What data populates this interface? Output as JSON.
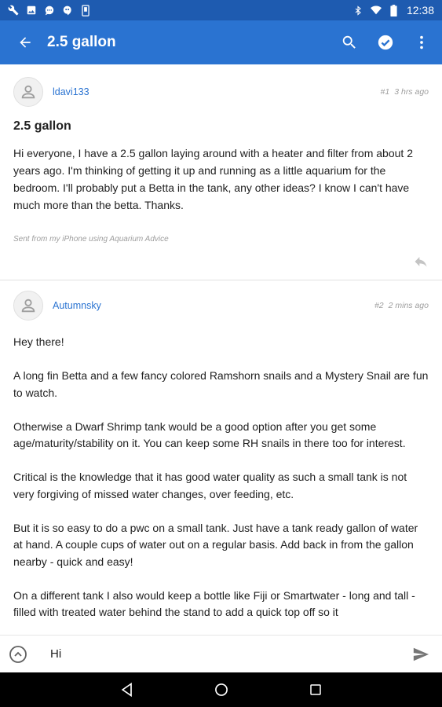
{
  "app": {
    "title": "2.5 gallon",
    "accent": "#2a73d1",
    "status_bar_color": "#1e5bb0"
  },
  "status_bar": {
    "time": "12:38",
    "left_icons": [
      "wrench-icon",
      "image-icon",
      "chat-bubble-icon",
      "hangouts-icon",
      "phone-outline-icon"
    ],
    "right_icons": [
      "bluetooth-icon",
      "wifi-icon",
      "battery-icon"
    ]
  },
  "toolbar": {
    "back_icon": "arrow-left-icon",
    "actions": [
      "search-icon",
      "check-circle-icon",
      "more-vert-icon"
    ]
  },
  "posts": [
    {
      "author": "ldavi133",
      "number": "#1",
      "time": "3 hrs ago",
      "title": "2.5 gallon",
      "paragraphs": [
        "Hi everyone, I have a 2.5 gallon laying around with a heater and filter from about 2 years ago. I'm thinking of getting it up and running as a little aquarium for the bedroom. I'll probably put a Betta in the tank, any other ideas? I know I can't have much more than the betta. Thanks."
      ],
      "signature": "Sent from my iPhone using Aquarium Advice"
    },
    {
      "author": "Autumnsky",
      "number": "#2",
      "time": "2 mins ago",
      "paragraphs": [
        "Hey there!",
        "A long fin Betta and a few fancy colored Ramshorn snails and a Mystery Snail are fun to watch.",
        "Otherwise a Dwarf Shrimp tank would be a good option after you get some age/maturity/stability on it. You can keep some RH snails in there too for interest.",
        "Critical is the knowledge that it has good water quality as such a small tank is not very forgiving of missed water changes, over feeding, etc.",
        "But it is so easy to do a pwc on a small tank. Just have a tank ready gallon of water at hand. A couple cups of water out on a regular basis. Add back in from the gallon nearby - quick and easy!",
        "On a different tank I also would keep a bottle like Fiji or Smartwater - long and tall - filled with treated water behind the stand to add a quick top off so it"
      ]
    }
  ],
  "composer": {
    "value": "Hi"
  }
}
